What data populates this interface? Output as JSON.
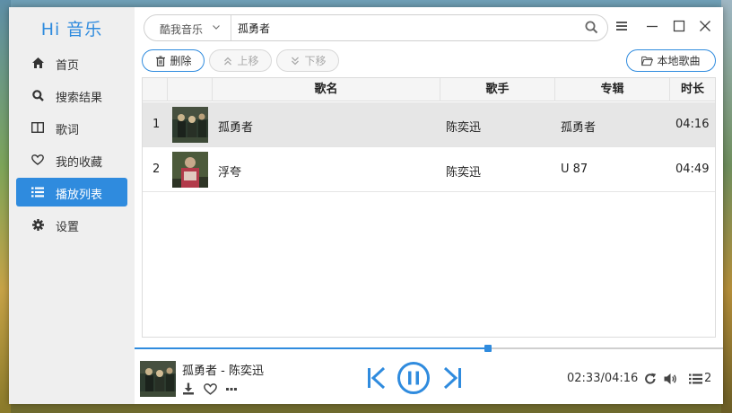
{
  "app": {
    "logo": "Hi 音乐"
  },
  "sidebar": {
    "items": [
      {
        "label": "首页",
        "icon": "home-icon",
        "active": false
      },
      {
        "label": "搜索结果",
        "icon": "search-icon",
        "active": false
      },
      {
        "label": "歌词",
        "icon": "lyrics-icon",
        "active": false
      },
      {
        "label": "我的收藏",
        "icon": "heart-icon",
        "active": false
      },
      {
        "label": "播放列表",
        "icon": "playlist-icon",
        "active": true
      },
      {
        "label": "设置",
        "icon": "gear-icon",
        "active": false
      }
    ]
  },
  "search": {
    "source": "酷我音乐",
    "value": "孤勇者"
  },
  "toolbar": {
    "delete_label": "删除",
    "move_up_label": "上移",
    "move_down_label": "下移",
    "local_songs_label": "本地歌曲"
  },
  "table": {
    "headers": {
      "title": "歌名",
      "artist": "歌手",
      "album": "专辑",
      "duration": "时长"
    },
    "rows": [
      {
        "index": "1",
        "title": "孤勇者",
        "artist": "陈奕迅",
        "album": "孤勇者",
        "duration": "04:16"
      },
      {
        "index": "2",
        "title": "浮夸",
        "artist": "陈奕迅",
        "album": "U 87",
        "duration": "04:49"
      }
    ]
  },
  "player": {
    "now_playing": "孤勇者 - 陈奕迅",
    "time": "02:33/04:16",
    "progress_fraction": 0.6,
    "queue_count": "2"
  },
  "colors": {
    "accent": "#2f8bde"
  }
}
